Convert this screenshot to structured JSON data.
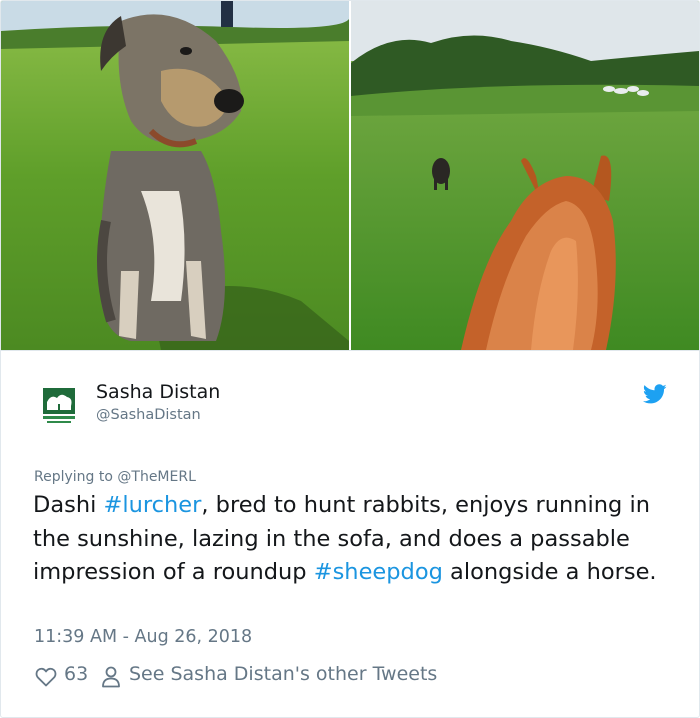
{
  "images": {
    "left": {
      "subject": "Scruffy grey-and-tan lurcher dog sitting on grass"
    },
    "right": {
      "subject": "View between a chestnut horse's ears of a dog running across a green field"
    }
  },
  "author": {
    "name": "Sasha Distan",
    "handle": "@SashaDistan",
    "avatar_icon": "tree-logo-icon"
  },
  "reply": {
    "prefix": "Replying to ",
    "mention": "@TheMERL"
  },
  "tweet": {
    "t1": "Dashi ",
    "h1": "#lurcher",
    "t2": ", bred to hunt rabbits, enjoys running in the sunshine, lazing in the sofa, and does a passable impression of a roundup ",
    "h2": "#sheepdog",
    "t3": " alongside a horse."
  },
  "timestamp": "11:39 AM - Aug 26, 2018",
  "actions": {
    "like_count": "63",
    "other_tweets_label": "See Sasha Distan's other Tweets"
  },
  "colors": {
    "link": "#1b95e0",
    "muted": "#657786",
    "text": "#14171a",
    "twitter_blue": "#1da1f2"
  }
}
